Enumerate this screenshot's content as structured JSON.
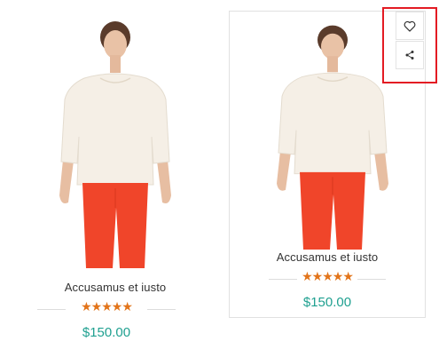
{
  "products": [
    {
      "name": "Accusamus et iusto",
      "rating_stars": "★★★★★",
      "rating": 5,
      "price": "$150.00"
    },
    {
      "name": "Accusamus et iusto",
      "rating_stars": "★★★★★",
      "rating": 5,
      "price": "$150.00"
    }
  ],
  "actions": {
    "wishlist_icon": "heart-icon",
    "share_icon": "share-icon"
  },
  "colors": {
    "price": "#1fa090",
    "star": "#e2741a",
    "highlight_border": "#e31b23"
  }
}
